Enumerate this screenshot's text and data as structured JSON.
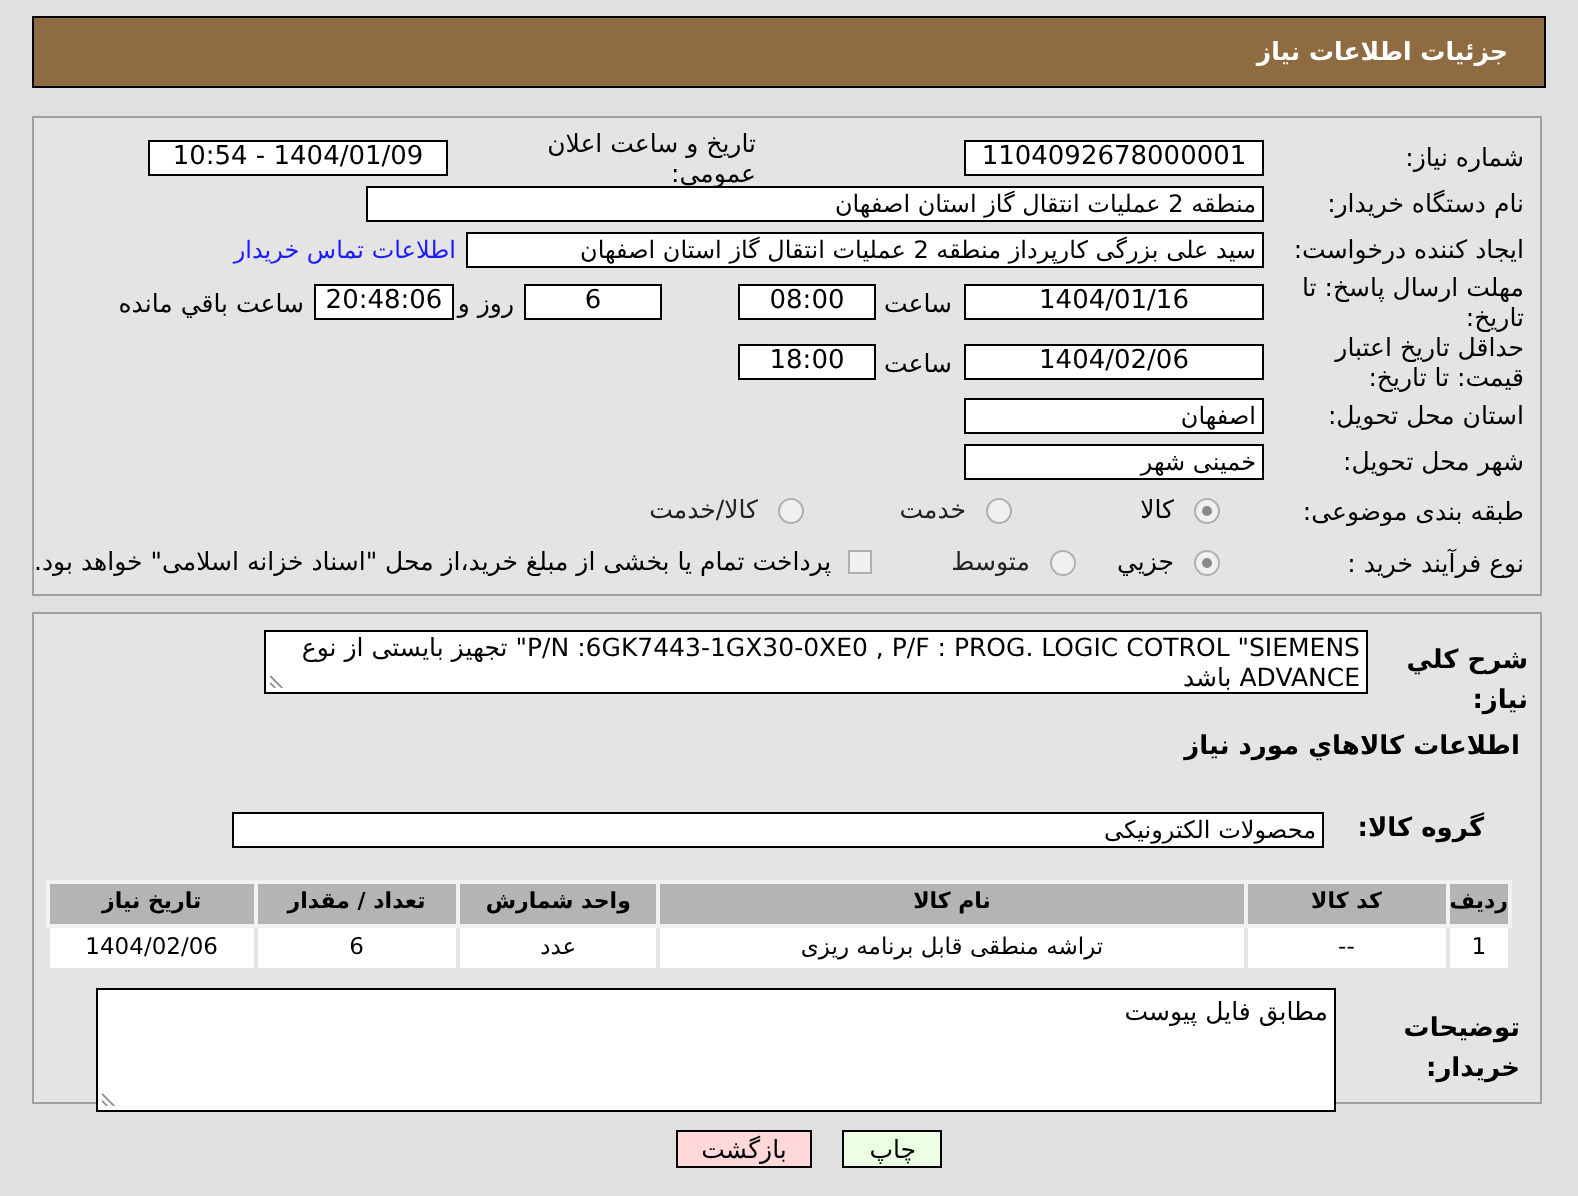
{
  "header": {
    "title": "جزئیات اطلاعات نیاز"
  },
  "need_number": {
    "label": "شماره نیاز:",
    "value": "1104092678000001"
  },
  "announce": {
    "label": "تاریخ و ساعت اعلان عمومي:",
    "value": "1404/01/09 - 10:54"
  },
  "buyer_org": {
    "label": "نام دستگاه خریدار:",
    "value": "منطقه 2 عملیات انتقال گاز استان اصفهان"
  },
  "requester": {
    "label": "ایجاد کننده درخواست:",
    "value": "سید علی بزرگی کارپرداز منطقه 2 عملیات انتقال گاز استان اصفهان",
    "link": "اطلاعات تماس خریدار"
  },
  "reply_deadline": {
    "label": "مهلت ارسال پاسخ: تا تاریخ:",
    "date": "1404/01/16",
    "time_label": "ساعت",
    "time": "08:00",
    "days": "6",
    "days_label": "روز و",
    "remaining": "20:48:06",
    "remaining_label": "ساعت باقي مانده"
  },
  "price_validity": {
    "label": "حداقل تاریخ اعتبار قیمت: تا تاریخ:",
    "date": "1404/02/06",
    "time_label": "ساعت",
    "time": "18:00"
  },
  "province": {
    "label": "استان محل تحویل:",
    "value": "اصفهان"
  },
  "city": {
    "label": "شهر محل تحویل:",
    "value": "خمینی شهر"
  },
  "category": {
    "label": "طبقه بندی موضوعی:",
    "options": [
      {
        "label": "کالا",
        "selected": true
      },
      {
        "label": "خدمت",
        "selected": false
      },
      {
        "label": "کالا/خدمت",
        "selected": false
      }
    ]
  },
  "purchase_process": {
    "label": "نوع فرآیند خرید :",
    "options": [
      {
        "label": "جزیي",
        "selected": true
      },
      {
        "label": "متوسط",
        "selected": false
      }
    ],
    "treasury": {
      "checked": false,
      "text": "پرداخت تمام یا بخشی از مبلغ خرید،از محل \"اسناد خزانه اسلامی\" خواهد بود."
    }
  },
  "description": {
    "label": "شرح کلي نیاز:",
    "value": "P/N :6GK7443-1GX30-0XE0 ,    P/F : PROG.  LOGIC COTROL \"SIEMENS\" تجهیز بایستی از نوع ADVANCE باشد"
  },
  "goods_heading": "اطلاعات کالاهاي مورد نیاز",
  "goods_group": {
    "label": "گروه کالا:",
    "value": "محصولات الکترونیکی"
  },
  "table": {
    "columns": [
      "ردیف",
      "کد کالا",
      "نام کالا",
      "واحد شمارش",
      "تعداد / مقدار",
      "تاریخ نیاز"
    ],
    "rows": [
      [
        "1",
        "--",
        "تراشه منطقی قابل برنامه ریزی",
        "عدد",
        "6",
        "1404/02/06"
      ]
    ]
  },
  "buyer_notes": {
    "label": "توضیحات خریدار:",
    "value": "مطابق فایل پیوست"
  },
  "buttons": [
    {
      "label": "چاپ",
      "kind": "print"
    },
    {
      "label": "بازگشت",
      "kind": "back"
    }
  ]
}
